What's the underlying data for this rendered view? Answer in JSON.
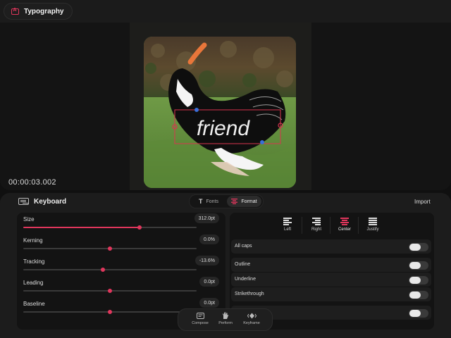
{
  "header": {
    "title": "Typography"
  },
  "preview": {
    "timecode": "00:00:03.002",
    "overlay_text": "friend"
  },
  "panel": {
    "title": "Keyboard",
    "tabs": [
      {
        "label": "Fonts"
      },
      {
        "label": "Format"
      }
    ],
    "import_label": "Import"
  },
  "sliders": [
    {
      "label": "Size",
      "value": "312.0pt",
      "position": 0.67
    },
    {
      "label": "Kerning",
      "value": "0.0%",
      "position": 0.5
    },
    {
      "label": "Tracking",
      "value": "-13.6%",
      "position": 0.46
    },
    {
      "label": "Leading",
      "value": "0.0pt",
      "position": 0.5
    },
    {
      "label": "Baseline",
      "value": "0.0pt",
      "position": 0.5
    }
  ],
  "alignment": {
    "options": [
      {
        "label": "Left"
      },
      {
        "label": "Right"
      },
      {
        "label": "Center"
      },
      {
        "label": "Justify"
      }
    ],
    "selected": "Center"
  },
  "toggles": [
    {
      "label": "All caps",
      "on": false
    },
    {
      "label": "Outline",
      "on": false
    },
    {
      "label": "Underline",
      "on": false
    },
    {
      "label": "Strikethrough",
      "on": false
    },
    {
      "label": "",
      "on": false
    }
  ],
  "dock": [
    {
      "label": "Compose"
    },
    {
      "label": "Perform"
    },
    {
      "label": "Keyframe"
    }
  ],
  "colors": {
    "accent": "#e0365c",
    "selection": "#d9344f",
    "handle": "#3a6fd8"
  }
}
